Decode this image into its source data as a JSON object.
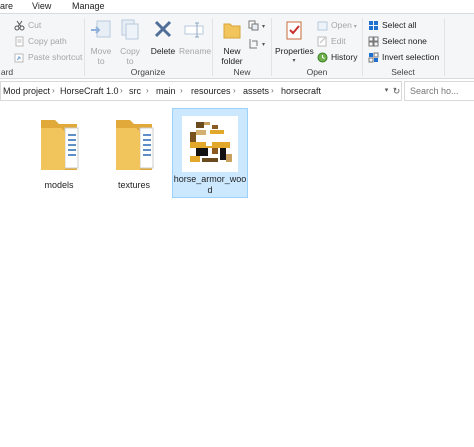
{
  "tabs": {
    "share": "are",
    "view": "View",
    "manage": "Manage"
  },
  "ribbon": {
    "clipboard": {
      "label": "ard",
      "cut": "Cut",
      "copy_path": "Copy path",
      "paste_shortcut": "Paste shortcut"
    },
    "organize": {
      "label": "Organize",
      "move_to_l1": "Move",
      "move_to_l2": "to",
      "copy_to_l1": "Copy",
      "copy_to_l2": "to",
      "delete": "Delete",
      "rename": "Rename"
    },
    "new": {
      "label": "New",
      "new_folder_l1": "New",
      "new_folder_l2": "folder"
    },
    "open": {
      "label": "Open",
      "properties": "Properties",
      "open": "Open",
      "edit": "Edit",
      "history": "History"
    },
    "select": {
      "label": "Select",
      "select_all": "Select all",
      "select_none": "Select none",
      "invert": "Invert selection"
    }
  },
  "address": {
    "crumbs": [
      "Mod project",
      "HorseCraft 1.0",
      "src",
      "main",
      "resources",
      "assets",
      "horsecraft"
    ]
  },
  "search": {
    "placeholder": "Search ho..."
  },
  "files": [
    {
      "name": "models",
      "type": "folder"
    },
    {
      "name": "textures",
      "type": "folder"
    },
    {
      "name": "horse_armor_wood",
      "type": "image"
    }
  ],
  "colors": {
    "folder": "#f2c55c",
    "folder_dark": "#e0a93a",
    "selection": "#cce8ff",
    "accent": "#1e6fd0"
  }
}
